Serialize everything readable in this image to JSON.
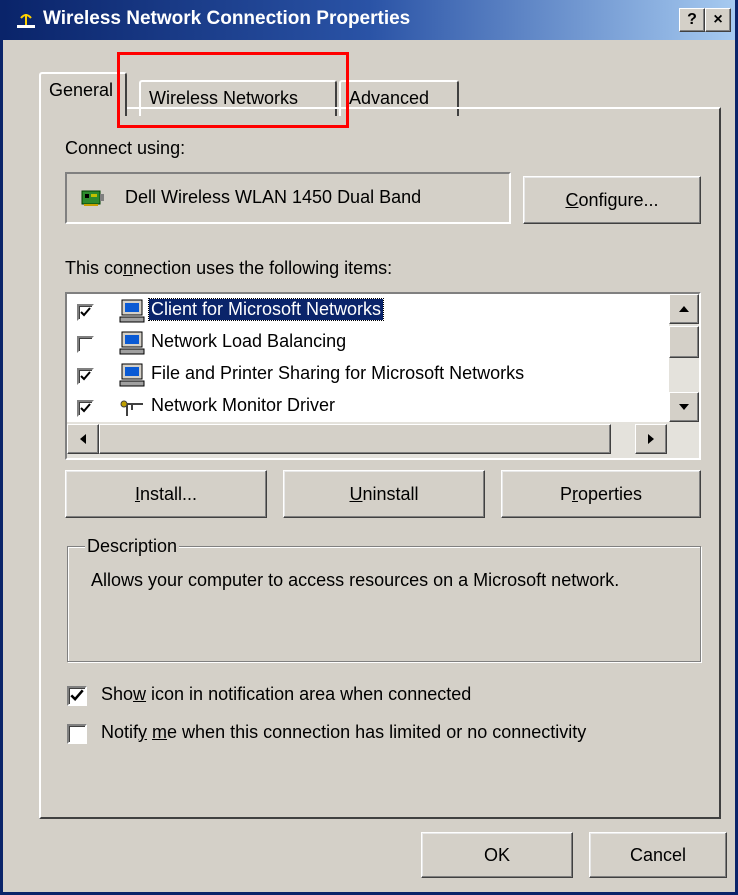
{
  "window": {
    "title": "Wireless Network Connection Properties",
    "help_label": "?",
    "close_label": "×"
  },
  "tabs": [
    {
      "label": "General",
      "selected": true
    },
    {
      "label": "Wireless Networks",
      "selected": false
    },
    {
      "label": "Advanced",
      "selected": false
    }
  ],
  "connect_using": {
    "label": "Connect using:",
    "adapter": "Dell Wireless WLAN 1450 Dual Band",
    "configure_button": {
      "pre": "",
      "accel": "C",
      "post": "onfigure..."
    }
  },
  "items": {
    "label_pre": "This co",
    "label_accel": "n",
    "label_post": "nection uses the following items:",
    "list": [
      {
        "label": "Client for Microsoft Networks",
        "checked": true,
        "selected": true,
        "icon": "network-client-icon"
      },
      {
        "label": "Network Load Balancing",
        "checked": false,
        "selected": false,
        "icon": "network-client-icon"
      },
      {
        "label": "File and Printer Sharing for Microsoft Networks",
        "checked": true,
        "selected": false,
        "icon": "network-client-icon"
      },
      {
        "label": "Network Monitor Driver",
        "checked": true,
        "selected": false,
        "icon": "protocol-icon"
      }
    ]
  },
  "buttons": {
    "install": {
      "pre": "",
      "accel": "I",
      "post": "nstall..."
    },
    "uninstall": {
      "pre": "",
      "accel": "U",
      "post": "ninstall"
    },
    "properties": {
      "pre": "P",
      "accel": "r",
      "post": "operties"
    }
  },
  "description": {
    "title": "Description",
    "text": "Allows your computer to access resources on a Microsoft network."
  },
  "options": [
    {
      "pre": "Sho",
      "accel": "w",
      "post": " icon in notification area when connected",
      "checked": true
    },
    {
      "pre": "Notif",
      "accel": "y",
      "post": " me when this connection has limited or no connectivity",
      "checked": false
    }
  ],
  "options_accel_extra": "m",
  "footer": {
    "ok": "OK",
    "cancel": "Cancel"
  },
  "colors": {
    "titlebar": "#0a246a",
    "face": "#d4d0c8",
    "selection": "#0a246a",
    "annotation": "#ff0000"
  }
}
